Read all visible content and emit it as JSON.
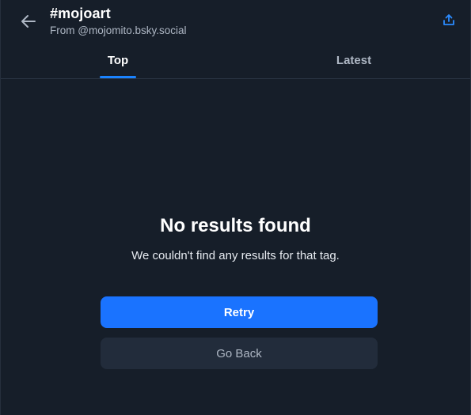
{
  "header": {
    "title": "#mojoart",
    "subtitle": "From @mojomito.bsky.social",
    "back_icon": "arrow-left-icon",
    "share_icon": "share-upload-icon"
  },
  "tabs": [
    {
      "label": "Top",
      "selected": true
    },
    {
      "label": "Latest",
      "selected": false
    }
  ],
  "empty_state": {
    "title": "No results found",
    "message": "We couldn't find any results for that tag."
  },
  "actions": {
    "retry_label": "Retry",
    "go_back_label": "Go Back"
  },
  "colors": {
    "background": "#161e29",
    "accent": "#1a73ff",
    "tab_indicator": "#1a83ff",
    "secondary_button": "#222c3b"
  }
}
